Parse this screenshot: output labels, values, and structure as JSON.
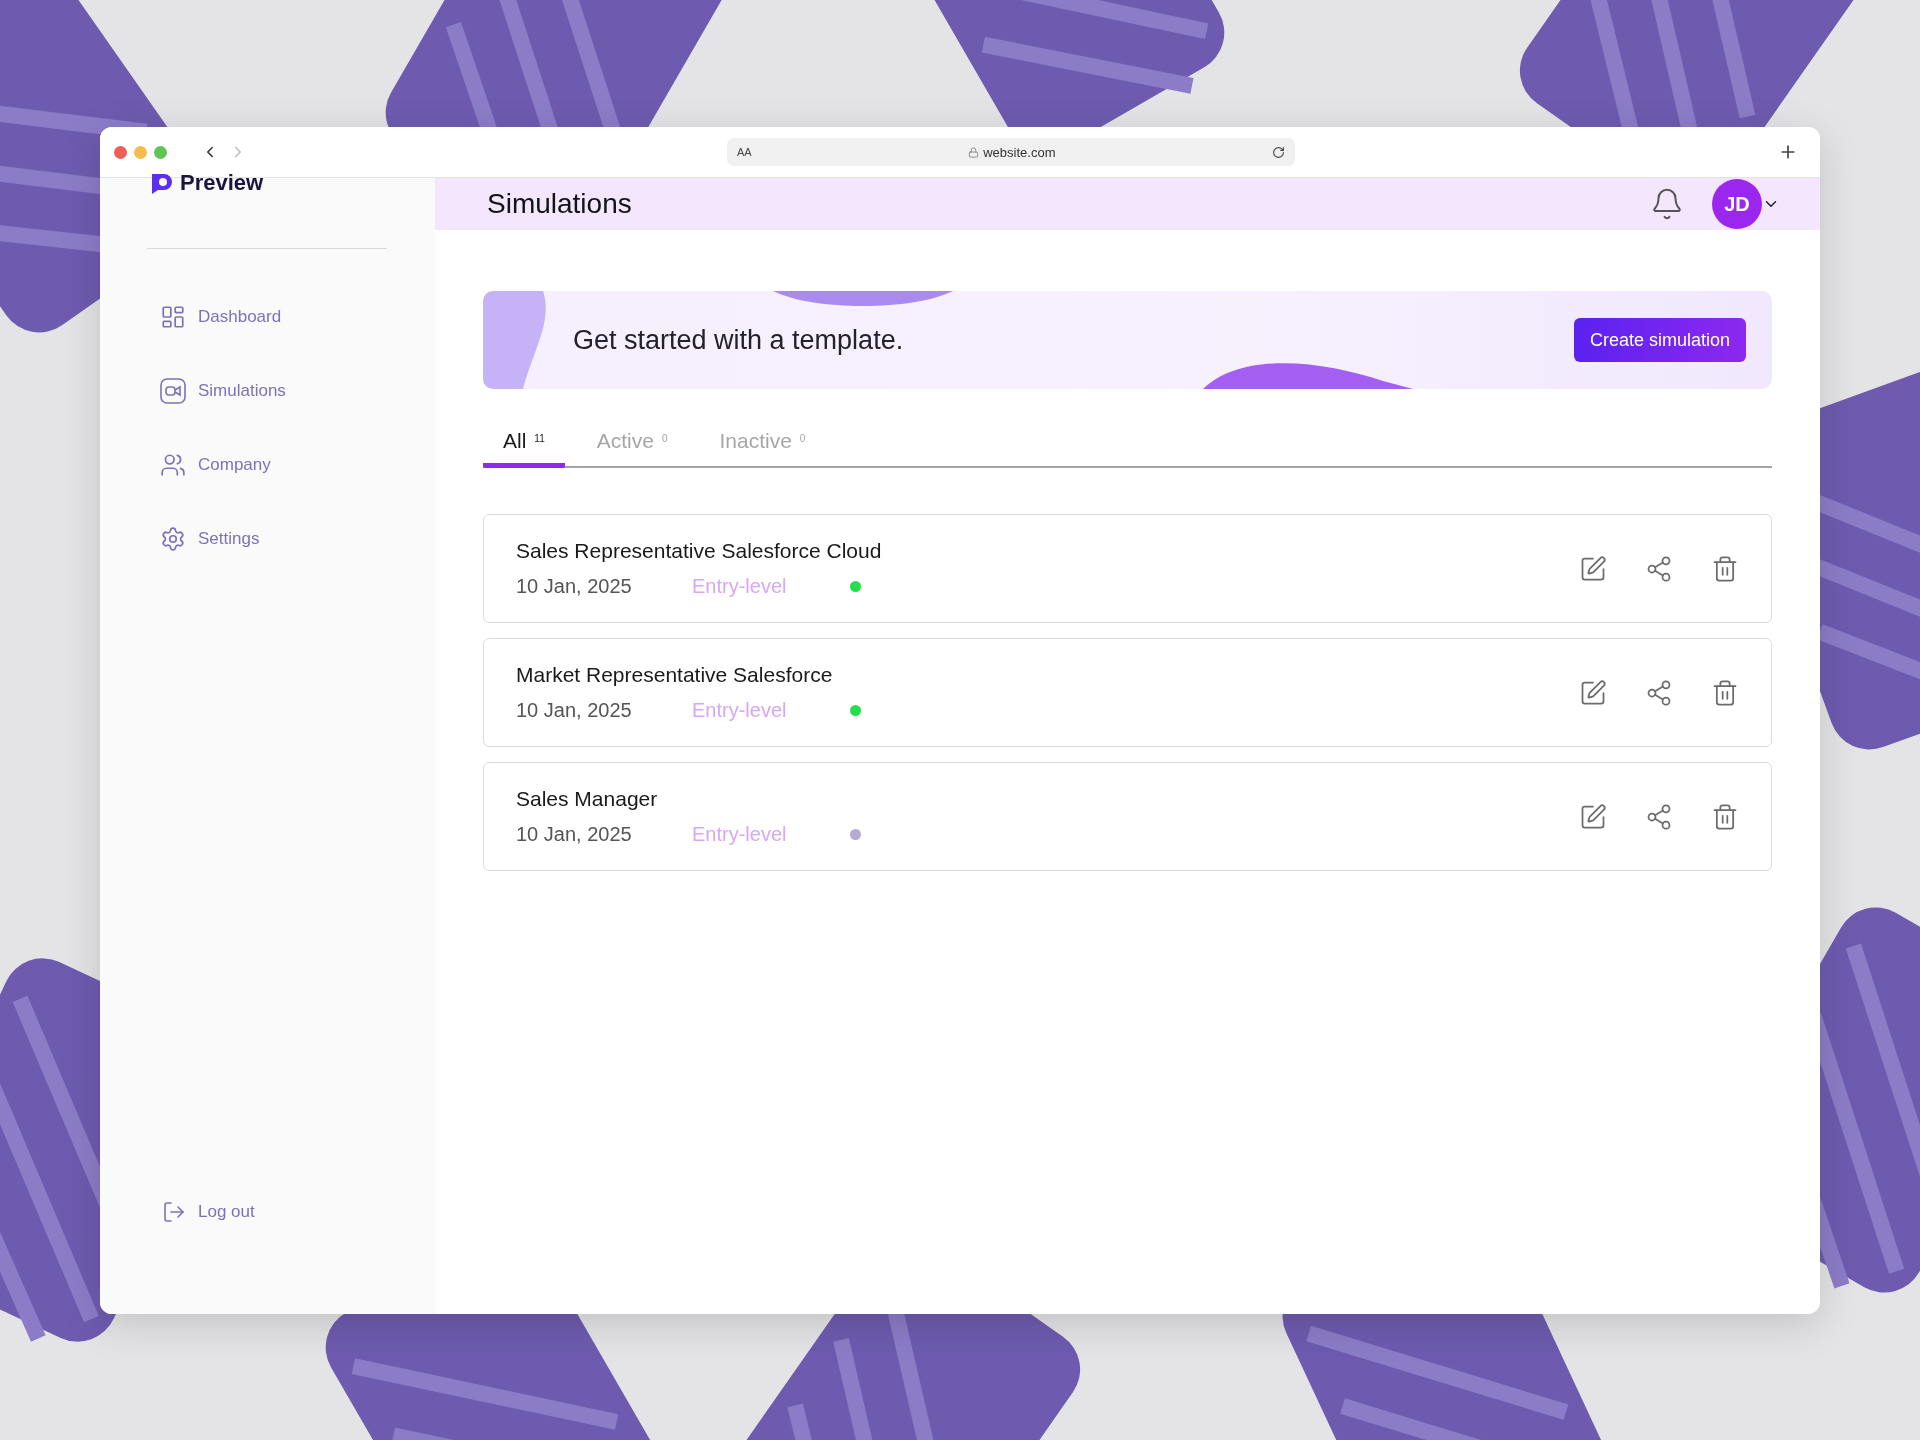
{
  "browser": {
    "reader_button": "AA",
    "address": "website.com"
  },
  "sidebar": {
    "brand": "Preview",
    "items": [
      {
        "label": "Dashboard"
      },
      {
        "label": "Simulations"
      },
      {
        "label": "Company"
      },
      {
        "label": "Settings"
      }
    ],
    "logout": "Log out"
  },
  "header": {
    "title": "Simulations",
    "avatar": "JD"
  },
  "banner": {
    "heading": "Get started with a template.",
    "button": "Create simulation"
  },
  "tabs": [
    {
      "label": "All",
      "count": "11",
      "selected": true
    },
    {
      "label": "Active",
      "count": "0",
      "selected": false
    },
    {
      "label": "Inactive",
      "count": "0",
      "selected": false
    }
  ],
  "simulations": [
    {
      "title": "Sales Representative Salesforce Cloud",
      "date": "10 Jan, 2025",
      "tier": "Entry-level",
      "color": "#22e04a"
    },
    {
      "title": "Market Representative Salesforce",
      "date": "10 Jan, 2025",
      "tier": "Entry-level",
      "color": "#22e04a"
    },
    {
      "title": "Sales Manager",
      "date": "10 Jan, 2025",
      "tier": "Entry-level",
      "color": "#b3abd4"
    }
  ]
}
